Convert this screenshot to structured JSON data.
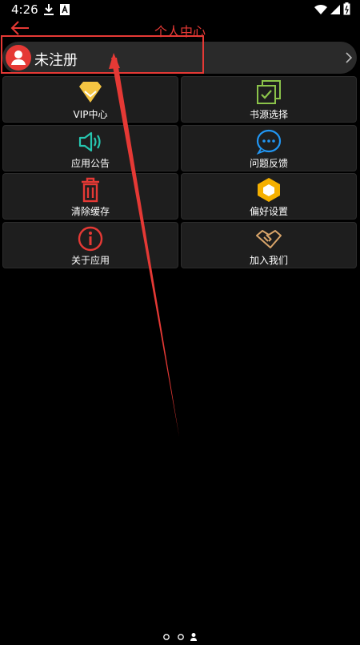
{
  "status_bar": {
    "time": "4:26"
  },
  "header": {
    "title": "个人中心"
  },
  "user": {
    "name": "未注册"
  },
  "menu": {
    "vip": "VIP中心",
    "source": "书源选择",
    "announce": "应用公告",
    "feedback": "问题反馈",
    "clear": "清除缓存",
    "prefs": "偏好设置",
    "about": "关于应用",
    "join": "加入我们"
  },
  "colors": {
    "accent": "#e53935",
    "vip": "#f5c542",
    "source": "#8bc34a",
    "announce": "#26c6b0",
    "feedback": "#2196f3",
    "clear": "#e53935",
    "prefs": "#f5b000",
    "about": "#e53935",
    "join": "#d9a56a"
  },
  "pager": {
    "current_page": 3,
    "total_pages": 3
  }
}
